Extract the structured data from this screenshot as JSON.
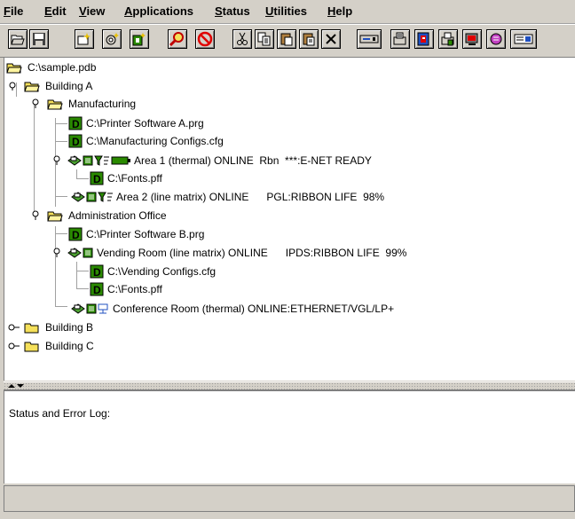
{
  "menu": [
    {
      "mn": "F",
      "rest": "ile"
    },
    {
      "mn": "E",
      "rest": "dit"
    },
    {
      "mn": "V",
      "rest": "iew"
    },
    {
      "mn": "A",
      "rest": "pplications"
    },
    {
      "mn": "S",
      "rest": "tatus"
    },
    {
      "mn": "U",
      "rest": "tilities"
    },
    {
      "mn": "H",
      "rest": "elp"
    }
  ],
  "toolbar_icons": [
    "open-folder-icon",
    "save-disk-icon",
    "new-item-icon",
    "settings-item-icon",
    "new-doc-icon",
    "search-printer-icon",
    "stop-icon",
    "cut-icon",
    "copy-icon",
    "paste-icon",
    "paste-special-icon",
    "delete-icon",
    "device-icon",
    "printer-config-icon",
    "red-document-icon",
    "printer-doc-icon",
    "network-printer-icon",
    "color-printer-icon",
    "panel-icon"
  ],
  "tree": {
    "root": "C:\\sample.pdb",
    "building_a": "Building A",
    "manufacturing": "Manufacturing",
    "mfg_file1": "C:\\Printer Software A.prg",
    "mfg_file2": "C:\\Manufacturing Configs.cfg",
    "area1": "Area 1 (thermal) ONLINE  Rbn  ***:E-NET READY",
    "area1_file": "C:\\Fonts.pff",
    "area2": "Area 2 (line matrix) ONLINE      PGL:RIBBON LIFE  98%",
    "admin": "Administration Office",
    "admin_file": "C:\\Printer Software B.prg",
    "vending": "Vending Room (line matrix) ONLINE      IPDS:RIBBON LIFE  99%",
    "vending_file1": "C:\\Vending Configs.cfg",
    "vending_file2": "C:\\Fonts.pff",
    "conference": "Conference Room (thermal) ONLINE:ETHERNET/VGL/LP+",
    "building_b": "Building B",
    "building_c": "Building C"
  },
  "log": {
    "title": "Status and Error Log:"
  },
  "colors": {
    "file_icon_green": "#2a8a00",
    "folder_yellow": "#f5e05a",
    "background": "#d4d0c8"
  }
}
